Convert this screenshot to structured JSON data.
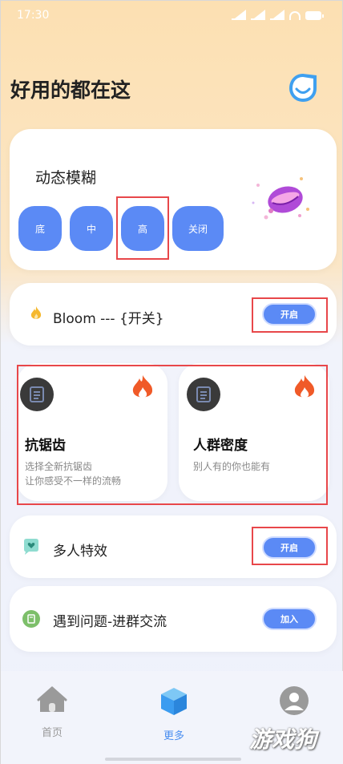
{
  "status": {
    "time": "17:30"
  },
  "page_title": "好用的都在这",
  "blur": {
    "title": "动态模糊",
    "options": [
      "底",
      "中",
      "高",
      "关闭"
    ]
  },
  "bloom": {
    "label": "Bloom --- {开关}",
    "button": "开启"
  },
  "features": [
    {
      "title": "抗锯齿",
      "desc_line1": "选择全新抗锯齿",
      "desc_line2": "让你感受不一样的流畅"
    },
    {
      "title": "人群密度",
      "desc_line1": "别人有的你也能有",
      "desc_line2": ""
    }
  ],
  "multi": {
    "label": "多人特效",
    "button": "开启"
  },
  "group": {
    "label": "遇到问题-进群交流",
    "button": "加入"
  },
  "nav": {
    "home": "首页",
    "more": "更多",
    "me": ""
  },
  "watermark": "游戏狗",
  "colors": {
    "accent": "#5b8af5",
    "highlight_box": "#e8474a",
    "fire": "#f05a28"
  }
}
